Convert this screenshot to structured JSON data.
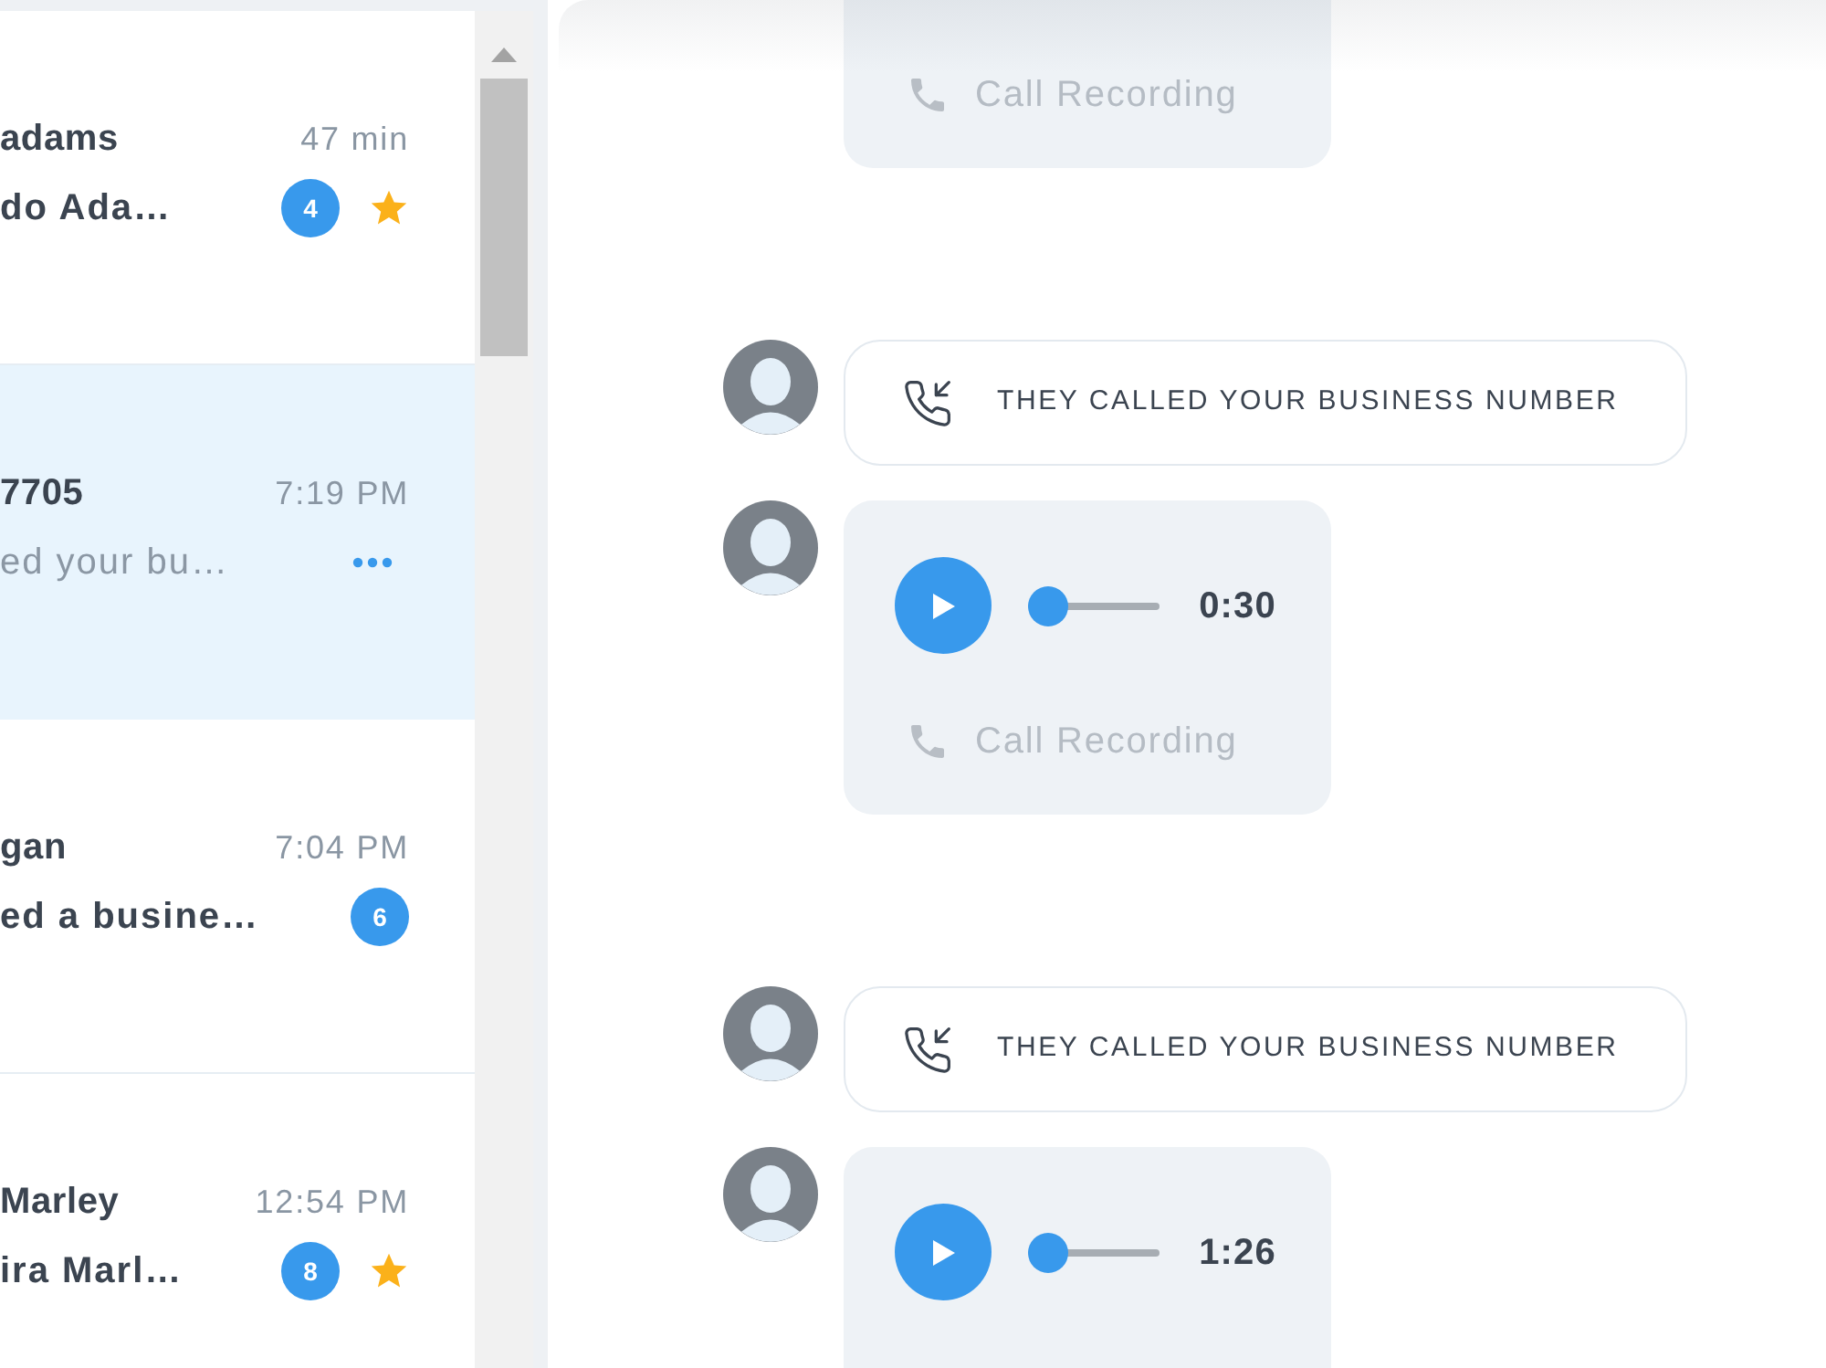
{
  "conversations": [
    {
      "name": "adams",
      "time": "47 min",
      "preview": "do Ada…",
      "badge": "4",
      "starred": true,
      "unread": true,
      "selected": false
    },
    {
      "name": "7705",
      "time": "7:19 PM",
      "preview": "ed your bu…",
      "starred": false,
      "unread": false,
      "selected": true
    },
    {
      "name": "gan",
      "time": "7:04 PM",
      "preview": "ed a busine…",
      "badge": "6",
      "starred": false,
      "unread": true,
      "selected": false
    },
    {
      "name": "Marley",
      "time": "12:54 PM",
      "preview": "ira Marl…",
      "badge": "8",
      "starred": true,
      "unread": true,
      "selected": false
    }
  ],
  "messages": [
    {
      "kind": "recording",
      "avatar": false,
      "label": "Call Recording"
    },
    {
      "kind": "event",
      "avatar": true,
      "text": "THEY CALLED YOUR BUSINESS NUMBER"
    },
    {
      "kind": "recording",
      "avatar": true,
      "duration": "0:30",
      "level": 0,
      "label": "Call Recording"
    },
    {
      "kind": "event",
      "avatar": true,
      "text": "THEY CALLED YOUR BUSINESS NUMBER"
    },
    {
      "kind": "recording",
      "avatar": true,
      "duration": "1:26",
      "level": 0
    }
  ]
}
